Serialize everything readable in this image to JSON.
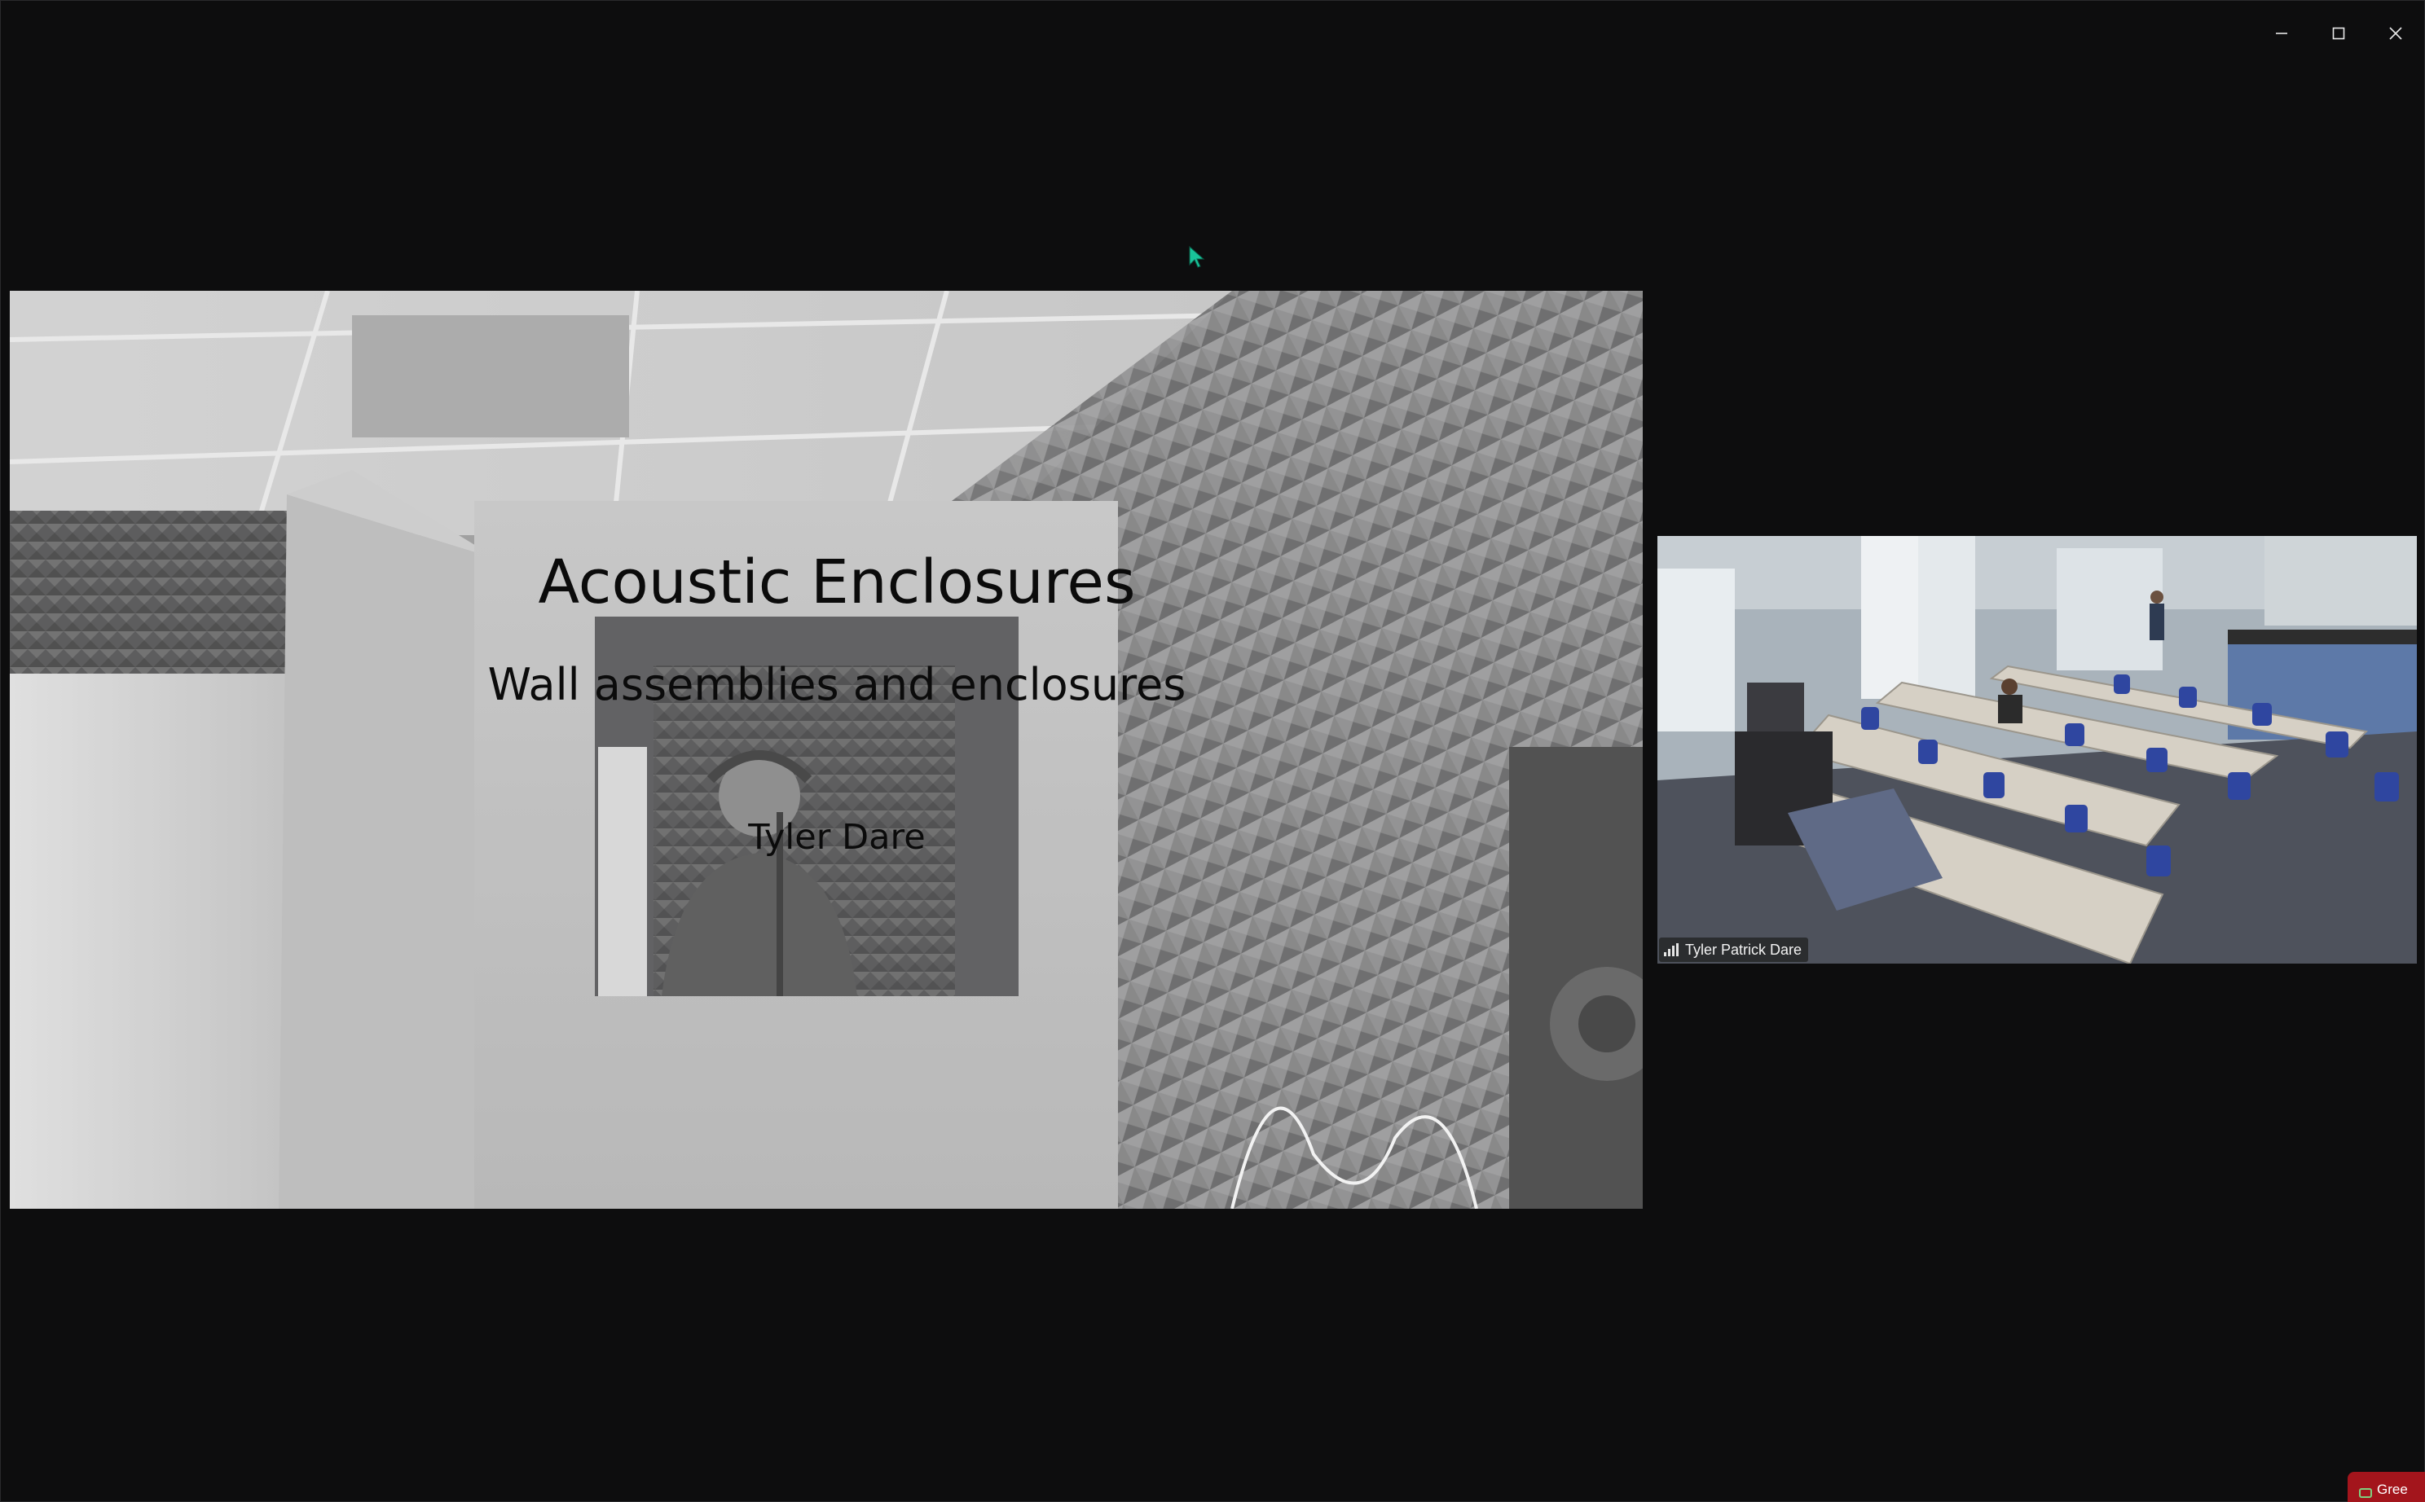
{
  "window": {
    "controls": {
      "minimize_icon": "minimize-icon",
      "maximize_icon": "maximize-icon",
      "close_icon": "close-icon"
    }
  },
  "shared_slide": {
    "title": "Acoustic Enclosures",
    "subtitle": "Wall assemblies and enclosures",
    "author": "Tyler Dare"
  },
  "participant": {
    "name": "Tyler Patrick Dare",
    "signal_icon": "signal-strength-icon"
  },
  "corner_badge": {
    "label": "Gree"
  },
  "colors": {
    "background": "#0d0d0e",
    "cursor": "#19c39a",
    "badge": "#a3151c"
  }
}
